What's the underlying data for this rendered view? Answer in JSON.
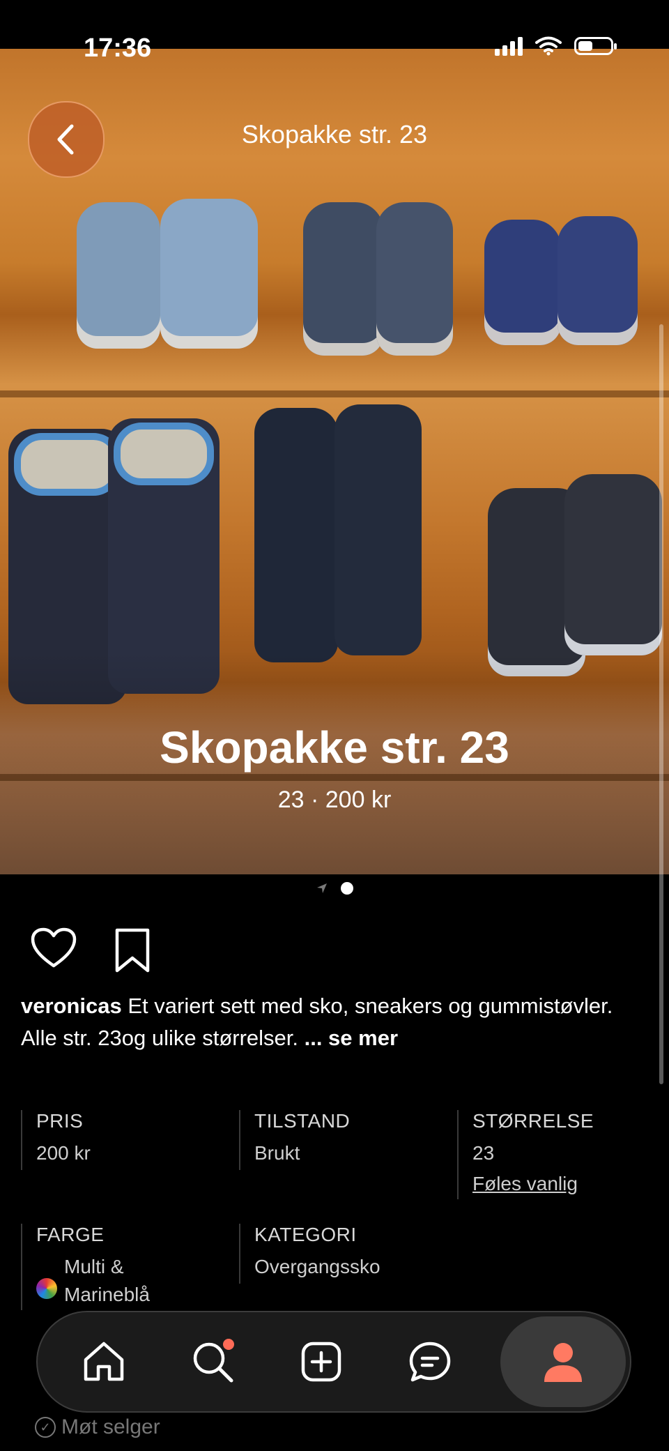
{
  "status_bar": {
    "time": "17:36"
  },
  "header": {
    "title": "Skopakke str. 23",
    "back_icon": "chevron-left-icon"
  },
  "listing": {
    "title": "Skopakke str. 23",
    "subtitle": "23 · 200 kr",
    "image_count": 2,
    "current_image": 2,
    "username": "veronicas",
    "description": " Et variert sett med sko, sneakers og gummistøvler. Alle str. 23og ulike størrelser. ",
    "more_label": "... se mer"
  },
  "attributes": {
    "price": {
      "label": "PRIS",
      "value": "200 kr"
    },
    "condition": {
      "label": "TILSTAND",
      "value": "Brukt"
    },
    "size": {
      "label": "STØRRELSE",
      "value": "23",
      "fit_link": "Føles vanlig"
    },
    "color": {
      "label": "FARGE",
      "value_line1": "Multi &",
      "value_line2": "Marineblå"
    },
    "category": {
      "label": "KATEGORI",
      "value": "Overgangssko"
    }
  },
  "below_fold": {
    "meet_seller": "Møt selger"
  },
  "tabbar": {
    "items": [
      {
        "name": "home",
        "icon": "home-icon",
        "active": false
      },
      {
        "name": "search",
        "icon": "search-icon",
        "active": false,
        "badge": true
      },
      {
        "name": "create",
        "icon": "plus-square-icon",
        "active": false
      },
      {
        "name": "messages",
        "icon": "chat-icon",
        "active": false
      },
      {
        "name": "profile",
        "icon": "person-icon",
        "active": true
      }
    ],
    "accent": "#ff7a62"
  }
}
